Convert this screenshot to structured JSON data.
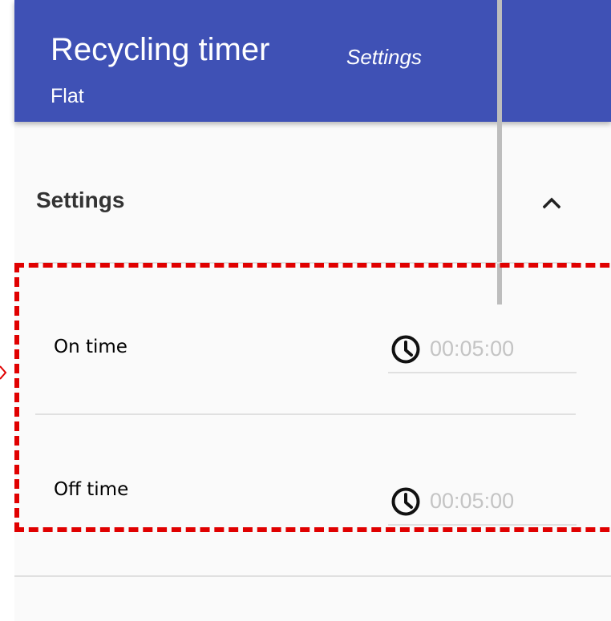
{
  "header": {
    "title": "Recycling timer",
    "subtitle": "Settings",
    "scope": "Flat"
  },
  "section": {
    "title": "Settings",
    "expanded": true,
    "toggle_icon": "chevron-up-icon"
  },
  "rows": [
    {
      "label": "On time",
      "value": "00:05:00",
      "icon": "clock-icon"
    },
    {
      "label": "Off time",
      "value": "00:05:00",
      "icon": "clock-icon"
    }
  ],
  "colors": {
    "header_bg": "#3f51b5",
    "panel_bg": "#fafafa",
    "highlight": "#e00000",
    "value_text": "#c4c4c4"
  }
}
